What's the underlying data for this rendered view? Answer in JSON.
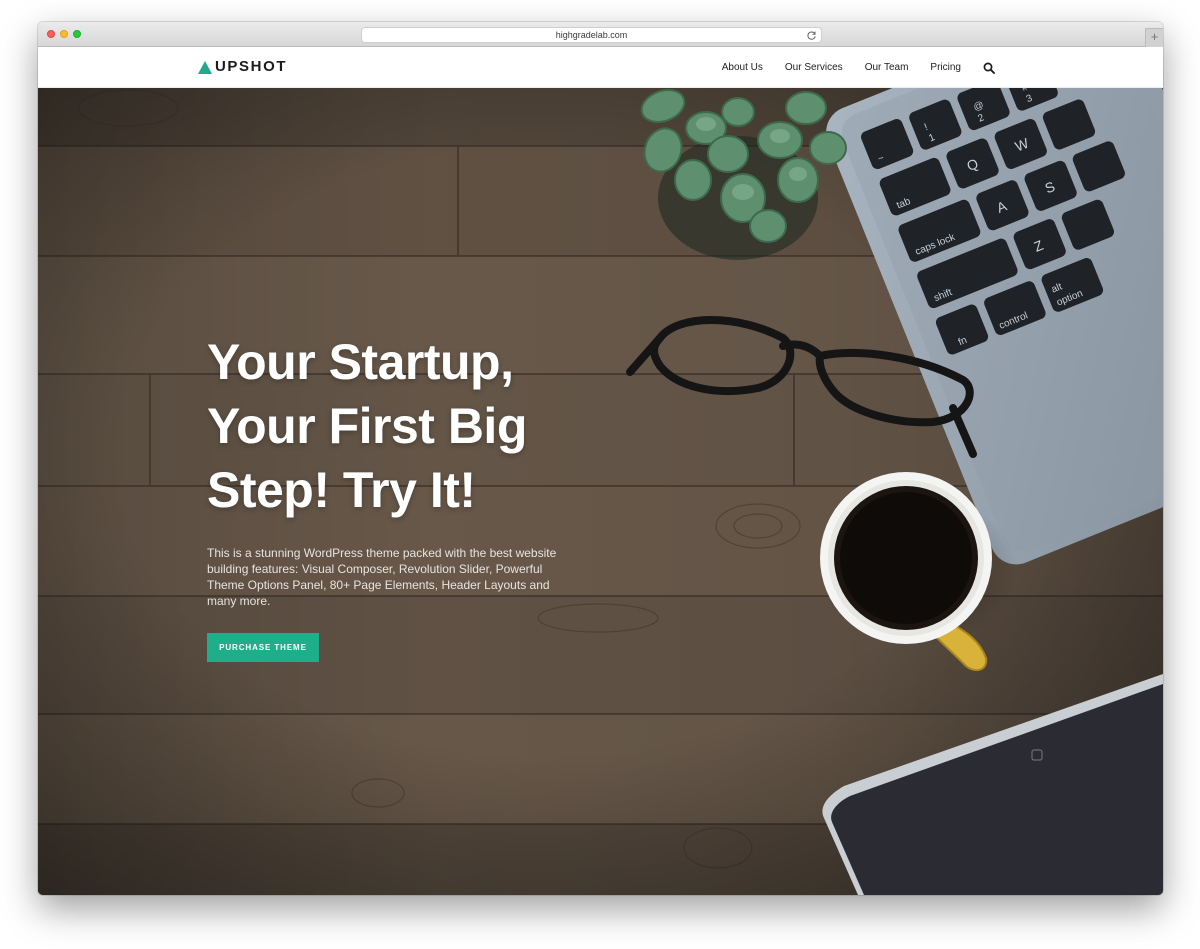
{
  "browser": {
    "url": "highgradelab.com",
    "new_tab_symbol": "+"
  },
  "header": {
    "logo_text": "UPSHOT",
    "nav": [
      {
        "label": "About Us"
      },
      {
        "label": "Our Services"
      },
      {
        "label": "Our Team"
      },
      {
        "label": "Pricing"
      }
    ],
    "search_icon": "search-icon"
  },
  "hero": {
    "title": "Your Startup, Your First Big Step! Try It!",
    "description": "This is a stunning WordPress theme packed with the best website building features: Visual Composer, Revolution Slider, Powerful Theme Options Panel, 80+ Page Elements, Header Layouts and many more.",
    "button_label": "PURCHASE THEME"
  },
  "colors": {
    "accent": "#1fae8a",
    "logo_triangle": "#23a98a",
    "wood": "#5d4f43"
  },
  "keyboard_keys": [
    "tab",
    "caps lock",
    "shift",
    "fn",
    "control",
    "option",
    "alt",
    "Q",
    "W",
    "A",
    "S",
    "Z",
    "1",
    "2",
    "3",
    "@",
    "#",
    "~",
    "!"
  ]
}
